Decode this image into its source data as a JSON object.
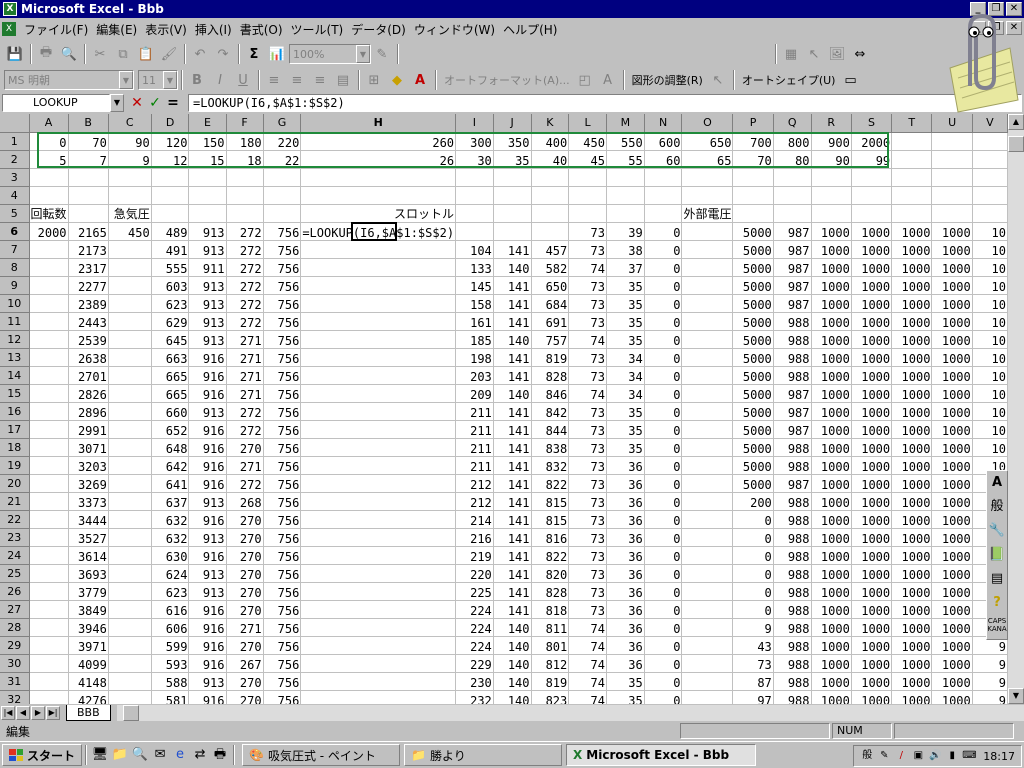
{
  "window": {
    "title": "Microsoft Excel - Bbb"
  },
  "menu": [
    "ファイル(F)",
    "編集(E)",
    "表示(V)",
    "挿入(I)",
    "書式(O)",
    "ツール(T)",
    "データ(D)",
    "ウィンドウ(W)",
    "ヘルプ(H)"
  ],
  "toolbar1": {
    "zoom": "100%",
    "sigma": "Σ"
  },
  "toolbar2": {
    "font_name": "MS 明朝",
    "font_size": "11",
    "bold": "B",
    "italic": "I",
    "underline": "U",
    "autoformat": "オートフォーマット(A)...",
    "image_adjust": "図形の調整(R)",
    "autoshape": "オートシェイプ(U)"
  },
  "formula_bar": {
    "name_box": "LOOKUP",
    "cancel": "✕",
    "enter": "✓",
    "equals": "=",
    "content": "=LOOKUP(I6,$A$1:$S$2)"
  },
  "columns": [
    "A",
    "B",
    "C",
    "D",
    "E",
    "F",
    "G",
    "H",
    "I",
    "J",
    "K",
    "L",
    "M",
    "N",
    "O",
    "P",
    "Q",
    "R",
    "S",
    "T",
    "U",
    "V"
  ],
  "rows": [
    {
      "n": "1",
      "c": [
        "0",
        "70",
        "90",
        "120",
        "150",
        "180",
        "220",
        "260",
        "300",
        "350",
        "400",
        "450",
        "550",
        "600",
        "650",
        "700",
        "800",
        "900",
        "2000",
        "",
        "",
        ""
      ]
    },
    {
      "n": "2",
      "c": [
        "5",
        "7",
        "9",
        "12",
        "15",
        "18",
        "22",
        "26",
        "30",
        "35",
        "40",
        "45",
        "55",
        "60",
        "65",
        "70",
        "80",
        "90",
        "99",
        "",
        "",
        ""
      ]
    },
    {
      "n": "3",
      "c": [
        "",
        "",
        "",
        "",
        "",
        "",
        "",
        "",
        "",
        "",
        "",
        "",
        "",
        "",
        "",
        "",
        "",
        "",
        "",
        "",
        "",
        ""
      ]
    },
    {
      "n": "4",
      "c": [
        "",
        "",
        "",
        "",
        "",
        "",
        "",
        "",
        "",
        "",
        "",
        "",
        "",
        "",
        "",
        "",
        "",
        "",
        "",
        "",
        "",
        ""
      ]
    },
    {
      "n": "5",
      "c": [
        "回転数",
        "",
        "急気圧",
        "",
        "",
        "",
        "",
        "スロットル",
        "",
        "",
        "",
        "",
        "",
        "",
        "外部電圧",
        "",
        "",
        "",
        "",
        "",
        "",
        ""
      ]
    },
    {
      "n": "6",
      "c": [
        "2000",
        "2165",
        "450",
        "489",
        "913",
        "272",
        "756",
        "=LOOKUP(I6,$A$1:$S$2)",
        "",
        "",
        "",
        "73",
        "39",
        "0",
        "",
        "5000",
        "987",
        "1000",
        "1000",
        "1000",
        "1000",
        "10"
      ]
    },
    {
      "n": "7",
      "c": [
        "",
        "2173",
        "",
        "491",
        "913",
        "272",
        "756",
        "",
        "104",
        "141",
        "457",
        "73",
        "38",
        "0",
        "",
        "5000",
        "987",
        "1000",
        "1000",
        "1000",
        "1000",
        "10"
      ]
    },
    {
      "n": "8",
      "c": [
        "",
        "2317",
        "",
        "555",
        "911",
        "272",
        "756",
        "",
        "133",
        "140",
        "582",
        "74",
        "37",
        "0",
        "",
        "5000",
        "987",
        "1000",
        "1000",
        "1000",
        "1000",
        "10"
      ]
    },
    {
      "n": "9",
      "c": [
        "",
        "2277",
        "",
        "603",
        "913",
        "272",
        "756",
        "",
        "145",
        "141",
        "650",
        "73",
        "35",
        "0",
        "",
        "5000",
        "987",
        "1000",
        "1000",
        "1000",
        "1000",
        "10"
      ]
    },
    {
      "n": "10",
      "c": [
        "",
        "2389",
        "",
        "623",
        "913",
        "272",
        "756",
        "",
        "158",
        "141",
        "684",
        "73",
        "35",
        "0",
        "",
        "5000",
        "987",
        "1000",
        "1000",
        "1000",
        "1000",
        "10"
      ]
    },
    {
      "n": "11",
      "c": [
        "",
        "2443",
        "",
        "629",
        "913",
        "272",
        "756",
        "",
        "161",
        "141",
        "691",
        "73",
        "35",
        "0",
        "",
        "5000",
        "988",
        "1000",
        "1000",
        "1000",
        "1000",
        "10"
      ]
    },
    {
      "n": "12",
      "c": [
        "",
        "2539",
        "",
        "645",
        "913",
        "271",
        "756",
        "",
        "185",
        "140",
        "757",
        "74",
        "35",
        "0",
        "",
        "5000",
        "988",
        "1000",
        "1000",
        "1000",
        "1000",
        "10"
      ]
    },
    {
      "n": "13",
      "c": [
        "",
        "2638",
        "",
        "663",
        "916",
        "271",
        "756",
        "",
        "198",
        "141",
        "819",
        "73",
        "34",
        "0",
        "",
        "5000",
        "988",
        "1000",
        "1000",
        "1000",
        "1000",
        "10"
      ]
    },
    {
      "n": "14",
      "c": [
        "",
        "2701",
        "",
        "665",
        "916",
        "271",
        "756",
        "",
        "203",
        "141",
        "828",
        "73",
        "34",
        "0",
        "",
        "5000",
        "988",
        "1000",
        "1000",
        "1000",
        "1000",
        "10"
      ]
    },
    {
      "n": "15",
      "c": [
        "",
        "2826",
        "",
        "665",
        "916",
        "271",
        "756",
        "",
        "209",
        "140",
        "846",
        "74",
        "34",
        "0",
        "",
        "5000",
        "987",
        "1000",
        "1000",
        "1000",
        "1000",
        "10"
      ]
    },
    {
      "n": "16",
      "c": [
        "",
        "2896",
        "",
        "660",
        "913",
        "272",
        "756",
        "",
        "211",
        "141",
        "842",
        "73",
        "35",
        "0",
        "",
        "5000",
        "987",
        "1000",
        "1000",
        "1000",
        "1000",
        "10"
      ]
    },
    {
      "n": "17",
      "c": [
        "",
        "2991",
        "",
        "652",
        "916",
        "272",
        "756",
        "",
        "211",
        "141",
        "844",
        "73",
        "35",
        "0",
        "",
        "5000",
        "987",
        "1000",
        "1000",
        "1000",
        "1000",
        "10"
      ]
    },
    {
      "n": "18",
      "c": [
        "",
        "3071",
        "",
        "648",
        "916",
        "270",
        "756",
        "",
        "211",
        "141",
        "838",
        "73",
        "35",
        "0",
        "",
        "5000",
        "988",
        "1000",
        "1000",
        "1000",
        "1000",
        "10"
      ]
    },
    {
      "n": "19",
      "c": [
        "",
        "3203",
        "",
        "642",
        "916",
        "271",
        "756",
        "",
        "211",
        "141",
        "832",
        "73",
        "36",
        "0",
        "",
        "5000",
        "988",
        "1000",
        "1000",
        "1000",
        "1000",
        "10"
      ]
    },
    {
      "n": "20",
      "c": [
        "",
        "3269",
        "",
        "641",
        "916",
        "272",
        "756",
        "",
        "212",
        "141",
        "822",
        "73",
        "36",
        "0",
        "",
        "5000",
        "987",
        "1000",
        "1000",
        "1000",
        "1000",
        "10"
      ]
    },
    {
      "n": "21",
      "c": [
        "",
        "3373",
        "",
        "637",
        "913",
        "268",
        "756",
        "",
        "212",
        "141",
        "815",
        "73",
        "36",
        "0",
        "",
        "200",
        "988",
        "1000",
        "1000",
        "1000",
        "1000",
        "10"
      ]
    },
    {
      "n": "22",
      "c": [
        "",
        "3444",
        "",
        "632",
        "916",
        "270",
        "756",
        "",
        "214",
        "141",
        "815",
        "73",
        "36",
        "0",
        "",
        "0",
        "988",
        "1000",
        "1000",
        "1000",
        "1000",
        "10"
      ]
    },
    {
      "n": "23",
      "c": [
        "",
        "3527",
        "",
        "632",
        "913",
        "270",
        "756",
        "",
        "216",
        "141",
        "816",
        "73",
        "36",
        "0",
        "",
        "0",
        "988",
        "1000",
        "1000",
        "1000",
        "1000",
        "10"
      ]
    },
    {
      "n": "24",
      "c": [
        "",
        "3614",
        "",
        "630",
        "916",
        "270",
        "756",
        "",
        "219",
        "141",
        "822",
        "73",
        "36",
        "0",
        "",
        "0",
        "988",
        "1000",
        "1000",
        "1000",
        "1000",
        "10"
      ]
    },
    {
      "n": "25",
      "c": [
        "",
        "3693",
        "",
        "624",
        "913",
        "270",
        "756",
        "",
        "220",
        "141",
        "820",
        "73",
        "36",
        "0",
        "",
        "0",
        "988",
        "1000",
        "1000",
        "1000",
        "1000",
        "10"
      ]
    },
    {
      "n": "26",
      "c": [
        "",
        "3779",
        "",
        "623",
        "913",
        "270",
        "756",
        "",
        "225",
        "141",
        "828",
        "73",
        "36",
        "0",
        "",
        "0",
        "988",
        "1000",
        "1000",
        "1000",
        "1000",
        "10"
      ]
    },
    {
      "n": "27",
      "c": [
        "",
        "3849",
        "",
        "616",
        "916",
        "270",
        "756",
        "",
        "224",
        "141",
        "818",
        "73",
        "36",
        "0",
        "",
        "0",
        "988",
        "1000",
        "1000",
        "1000",
        "1000",
        "10"
      ]
    },
    {
      "n": "28",
      "c": [
        "",
        "3946",
        "",
        "606",
        "916",
        "271",
        "756",
        "",
        "224",
        "140",
        "811",
        "74",
        "36",
        "0",
        "",
        "9",
        "988",
        "1000",
        "1000",
        "1000",
        "1000",
        "10"
      ]
    },
    {
      "n": "29",
      "c": [
        "",
        "3971",
        "",
        "599",
        "916",
        "270",
        "756",
        "",
        "224",
        "140",
        "801",
        "74",
        "36",
        "0",
        "",
        "43",
        "988",
        "1000",
        "1000",
        "1000",
        "1000",
        "9"
      ]
    },
    {
      "n": "30",
      "c": [
        "",
        "4099",
        "",
        "593",
        "916",
        "267",
        "756",
        "",
        "229",
        "140",
        "812",
        "74",
        "36",
        "0",
        "",
        "73",
        "988",
        "1000",
        "1000",
        "1000",
        "1000",
        "9"
      ]
    },
    {
      "n": "31",
      "c": [
        "",
        "4148",
        "",
        "588",
        "913",
        "270",
        "756",
        "",
        "230",
        "140",
        "819",
        "74",
        "35",
        "0",
        "",
        "87",
        "988",
        "1000",
        "1000",
        "1000",
        "1000",
        "9"
      ]
    },
    {
      "n": "32",
      "c": [
        "",
        "4276",
        "",
        "581",
        "916",
        "270",
        "756",
        "",
        "232",
        "140",
        "823",
        "74",
        "35",
        "0",
        "",
        "97",
        "988",
        "1000",
        "1000",
        "1000",
        "1000",
        "9"
      ]
    }
  ],
  "sheet_tab": "BBB",
  "status": {
    "mode": "編集",
    "num": "NUM"
  },
  "taskbar": {
    "start": "スタート",
    "buttons": [
      "吸気圧式 - ペイント",
      "勝より",
      "Microsoft Excel - Bbb"
    ],
    "clock": "18:17"
  },
  "palette": {
    "kana_label": "般",
    "caps_label": "CAPS KANA"
  },
  "colors": {
    "titlebar": "#000080",
    "copy_border": "#1f8a3a",
    "face": "#c0c0c0"
  }
}
